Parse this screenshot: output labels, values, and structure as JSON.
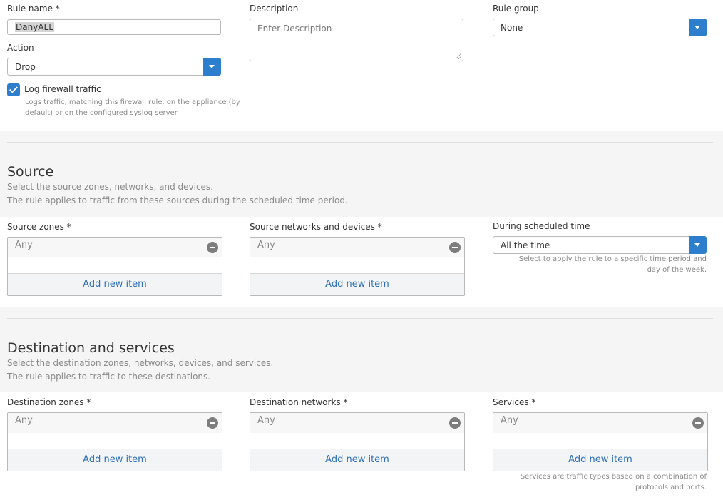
{
  "rule": {
    "name_label": "Rule name *",
    "name_value": "DanyALL",
    "description_label": "Description",
    "description_placeholder": "Enter Description",
    "group_label": "Rule group",
    "group_value": "None",
    "action_label": "Action",
    "action_value": "Drop",
    "log_label": "Log firewall traffic",
    "log_checked": true,
    "log_help_line1": "Logs traffic, matching this firewall rule, on the appliance (by",
    "log_help_line2": "default) or on the configured syslog server."
  },
  "source": {
    "title": "Source",
    "desc_line1": "Select the source zones, networks, and devices.",
    "desc_line2": "The rule applies to traffic from these sources during the scheduled time period.",
    "zones_label": "Source zones *",
    "zones_item": "Any",
    "zones_add": "Add new item",
    "networks_label": "Source networks and devices *",
    "networks_item": "Any",
    "networks_add": "Add new item",
    "schedule_label": "During scheduled time",
    "schedule_value": "All the time",
    "schedule_help_line1": "Select to apply the rule to a specific time period and",
    "schedule_help_line2": "day of the week."
  },
  "destination": {
    "title": "Destination and services",
    "desc_line1": "Select the destination zones, networks, devices, and services.",
    "desc_line2": "The rule applies to traffic to these destinations.",
    "zones_label": "Destination zones *",
    "zones_item": "Any",
    "zones_add": "Add new item",
    "networks_label": "Destination networks *",
    "networks_item": "Any",
    "networks_add": "Add new item",
    "services_label": "Services *",
    "services_item": "Any",
    "services_add": "Add new item",
    "services_help_line1": "Services are traffic types based on a combination of",
    "services_help_line2": "protocols and ports."
  },
  "colors": {
    "accent": "#2d7fcd",
    "link": "#2d6fb8",
    "band": "#f5f5f5"
  }
}
